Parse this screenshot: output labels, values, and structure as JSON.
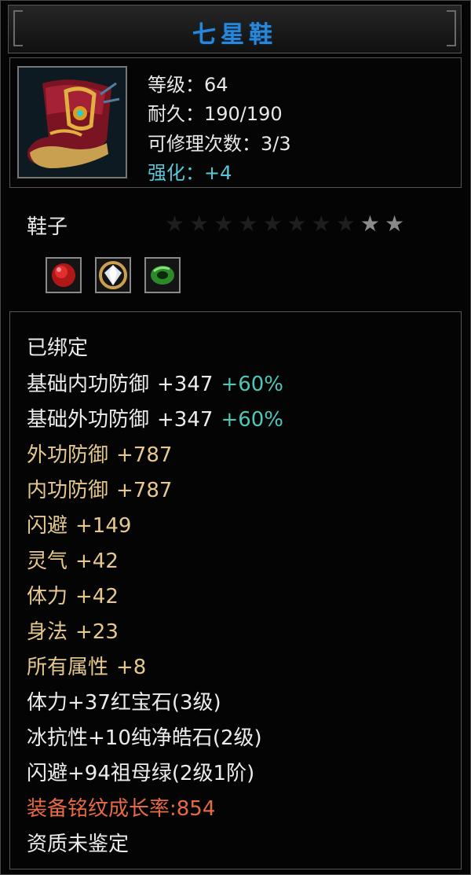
{
  "item": {
    "name": "七星鞋",
    "level_text": "等级：64",
    "durability_text": "耐久：190/190",
    "repair_text": "可修理次数：3/3",
    "enhance_text": "强化：+4",
    "type": "鞋子",
    "star_rating": {
      "lit": 2,
      "total": 10
    },
    "gems": [
      {
        "name": "ruby-gem-icon",
        "color": "#d82020"
      },
      {
        "name": "diamond-gem-icon",
        "color": "#e8e8f0"
      },
      {
        "name": "emerald-gem-icon",
        "color": "#3aa030"
      }
    ]
  },
  "attributes": {
    "bound": "已绑定",
    "base_inner_def": {
      "label": "基础内功防御",
      "value": "+347",
      "pct": "+60%"
    },
    "base_outer_def": {
      "label": "基础外功防御",
      "value": "+347",
      "pct": "+60%"
    },
    "outer_def": {
      "label": "外功防御",
      "value": "+787"
    },
    "inner_def": {
      "label": "内功防御",
      "value": "+787"
    },
    "dodge": {
      "label": "闪避",
      "value": "+149"
    },
    "spirit": {
      "label": "灵气",
      "value": "+42"
    },
    "vitality": {
      "label": "体力",
      "value": "+42"
    },
    "agility": {
      "label": "身法",
      "value": "+23"
    },
    "all_attr": {
      "label": "所有属性",
      "value": "+8"
    },
    "gem_line_1": "体力+37红宝石(3级)",
    "gem_line_2": "冰抗性+10纯净皓石(2级)",
    "gem_line_3": "闪避+94祖母绿(2级1阶)",
    "growth": "装备铭纹成长率:854",
    "quality": "资质未鉴定"
  },
  "colors": {
    "title": "#2a87d8",
    "enhance": "#58c8d8",
    "percent": "#4fc6b8",
    "gold_attr": "#e6c88e",
    "growth": "#e86a42"
  }
}
